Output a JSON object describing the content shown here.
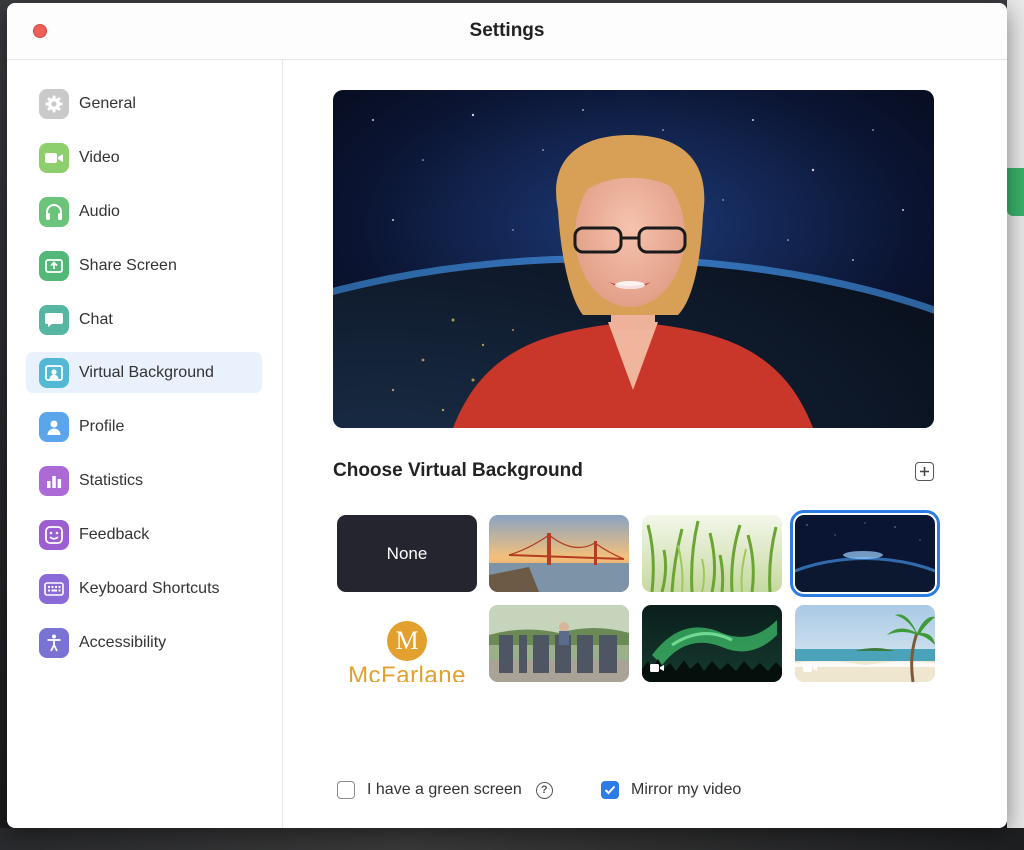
{
  "window": {
    "title": "Settings"
  },
  "sidebar": {
    "items": [
      {
        "label": "General",
        "icon": "gear-icon",
        "color": "#c9c9c9"
      },
      {
        "label": "Video",
        "icon": "video-camera-icon",
        "color": "#8ccf6c"
      },
      {
        "label": "Audio",
        "icon": "headphones-icon",
        "color": "#6cc37a"
      },
      {
        "label": "Share Screen",
        "icon": "share-screen-icon",
        "color": "#53b877"
      },
      {
        "label": "Chat",
        "icon": "chat-bubble-icon",
        "color": "#57b6a2"
      },
      {
        "label": "Virtual Background",
        "icon": "virtual-background-icon",
        "color": "#52b8d6",
        "active": true
      },
      {
        "label": "Profile",
        "icon": "person-icon",
        "color": "#5aa5ec"
      },
      {
        "label": "Statistics",
        "icon": "bar-chart-icon",
        "color": "#ab6ad6"
      },
      {
        "label": "Feedback",
        "icon": "smiley-icon",
        "color": "#9b5fd1"
      },
      {
        "label": "Keyboard Shortcuts",
        "icon": "keyboard-icon",
        "color": "#8a6ad6"
      },
      {
        "label": "Accessibility",
        "icon": "accessibility-icon",
        "color": "#7a73d4"
      }
    ]
  },
  "main": {
    "section_title": "Choose Virtual Background",
    "none_label": "None",
    "logo_text": "McFarlane",
    "logo_letter": "M",
    "selected_background": "earth-from-space",
    "green_screen_label": "I have a green screen",
    "green_screen_checked": false,
    "mirror_label": "Mirror my video",
    "mirror_checked": true
  },
  "colors": {
    "accent": "#2d7ce6",
    "close": "#ec5f5a",
    "logo": "#e2a12e"
  }
}
